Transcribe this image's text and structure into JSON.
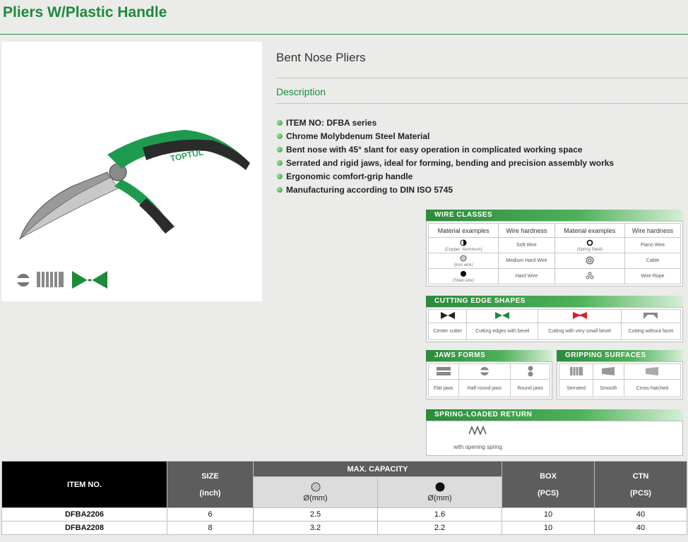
{
  "page": {
    "title": "Pliers W/Plastic Handle"
  },
  "product": {
    "name": "Bent Nose Pliers",
    "description_heading": "Description",
    "features": [
      "ITEM NO: DFBA series",
      "Chrome Molybdenum Steel Material",
      "Bent nose with 45° slant for easy operation in complicated working space",
      "Serrated and rigid jaws, ideal for forming, bending and precision assembly works",
      "Ergonomic comfort-grip handle",
      "Manufacturing according to DIN ISO 5745"
    ],
    "brand_mark": "TOPTUL"
  },
  "legend": {
    "wire_classes": {
      "title": "WIRE CLASSES",
      "headers": [
        "Material examples",
        "Wire hardness",
        "Material examples",
        "Wire hardness"
      ],
      "rows": [
        {
          "mat1": "(Copper, Aluminum)",
          "hard1": "Soft Wire",
          "mat2": "(Spring Steel)",
          "hard2": "Piano Wire"
        },
        {
          "mat1": "(Iron wire)",
          "hard1": "Medium Hard Wire",
          "mat2": "",
          "hard2": "Cable"
        },
        {
          "mat1": "(Steel wire)",
          "hard1": "Hard Wire",
          "mat2": "",
          "hard2": "Wire Rope"
        }
      ]
    },
    "cutting_edge": {
      "title": "CUTTING EDGE SHAPES",
      "items": [
        "Center cutter",
        "Cutting edges with bevel",
        "Cutting with very small bevel",
        "Cutting without facet"
      ]
    },
    "jaws_forms": {
      "title": "JAWS FORMS",
      "items": [
        "Flat jaws",
        "Half-round jaws",
        "Round jaws"
      ]
    },
    "gripping": {
      "title": "GRIPPING SURFACES",
      "items": [
        "Serrated",
        "Smooth",
        "Cross-hatched"
      ]
    },
    "spring": {
      "title": "SPRING-LOADED RETURN",
      "caption": "with opening spring"
    }
  },
  "spec_table": {
    "headers": {
      "item_no": "ITEM NO.",
      "size": "SIZE",
      "size_unit": "(inch)",
      "max_capacity": "MAX. CAPACITY",
      "cap1_unit": "Ø(mm)",
      "cap2_unit": "Ø(mm)",
      "box": "BOX",
      "box_unit": "(PCS)",
      "ctn": "CTN",
      "ctn_unit": "(PCS)"
    },
    "rows": [
      {
        "item": "DFBA2206",
        "size": "6",
        "cap1": "2.5",
        "cap2": "1.6",
        "box": "10",
        "ctn": "40"
      },
      {
        "item": "DFBA2208",
        "size": "8",
        "cap1": "3.2",
        "cap2": "2.2",
        "box": "10",
        "ctn": "40"
      }
    ]
  },
  "colors": {
    "brand_green": "#1e8a3c",
    "header_dark": "#5d5d5d",
    "header_black": "#000000"
  }
}
